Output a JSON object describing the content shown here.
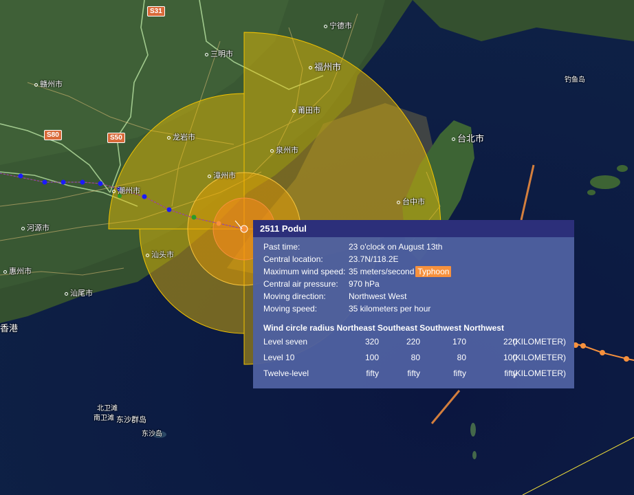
{
  "map": {
    "cities": [
      {
        "name": "宁德市",
        "id": "ningde"
      },
      {
        "name": "三明市",
        "id": "sanming"
      },
      {
        "name": "福州市",
        "id": "fuzhou"
      },
      {
        "name": "赣州市",
        "id": "ganzhou"
      },
      {
        "name": "莆田市",
        "id": "putian"
      },
      {
        "name": "龙岩市",
        "id": "longyan"
      },
      {
        "name": "泉州市",
        "id": "quanzhou"
      },
      {
        "name": "漳州市",
        "id": "zhangzhou"
      },
      {
        "name": "潮州市",
        "id": "chaozhou"
      },
      {
        "name": "河源市",
        "id": "heyuan"
      },
      {
        "name": "汕头市",
        "id": "shantou"
      },
      {
        "name": "惠州市",
        "id": "huizhou"
      },
      {
        "name": "汕尾市",
        "id": "shanwei"
      },
      {
        "name": "台北市",
        "id": "taipei"
      },
      {
        "name": "台中市",
        "id": "taichung"
      },
      {
        "name": "钓鱼岛",
        "id": "diaoyudao"
      },
      {
        "name": "香港",
        "id": "hongkong"
      },
      {
        "name": "北卫滩",
        "id": "beiweitan"
      },
      {
        "name": "南卫滩",
        "id": "nanweitan"
      },
      {
        "name": "东沙群岛",
        "id": "dongsha-islands"
      },
      {
        "name": "东沙岛",
        "id": "dongsha-island"
      }
    ],
    "road_shields": [
      "S31",
      "S80",
      "S50"
    ],
    "colors": {
      "wind_circle": "#f5c400",
      "track_past": "#1a1aff",
      "track_forecast": "#f7913d"
    }
  },
  "popup": {
    "title": "2511 Podul",
    "rows": [
      {
        "label": "Past time:",
        "value": "23 o'clock on August 13th"
      },
      {
        "label": "Central location:",
        "value": "23.7N/118.2E"
      },
      {
        "label": "Maximum wind speed:",
        "value": "35 meters/second",
        "badge": "Typhoon"
      },
      {
        "label": "Central air pressure:",
        "value": "970 hPa"
      },
      {
        "label": "Moving direction:",
        "value": "Northwest West"
      },
      {
        "label": "Moving speed:",
        "value": "35 kilometers per hour"
      }
    ],
    "wind_header": "Wind circle radius Northeast Southeast Southwest Northwest",
    "wind_rows": [
      {
        "level": "Level seven",
        "ne": "320",
        "se": "220",
        "sw": "170",
        "nw": "220",
        "unit": "(KILOMETER)"
      },
      {
        "level": "Level 10",
        "ne": "100",
        "se": "80",
        "sw": "80",
        "nw": "100",
        "unit": "(KILOMETER)"
      },
      {
        "level": "Twelve-level",
        "ne": "fifty",
        "se": "fifty",
        "sw": "fifty",
        "nw": "fifty",
        "unit": "(KILOMETER)"
      }
    ]
  }
}
